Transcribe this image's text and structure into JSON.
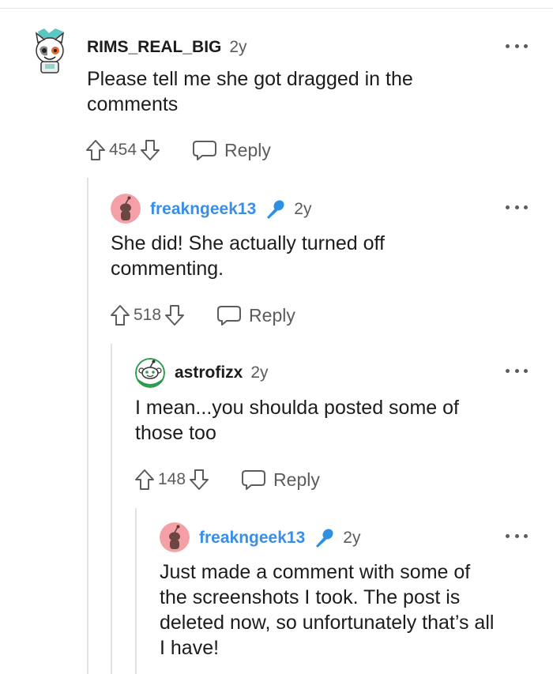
{
  "comments": [
    {
      "username": "RIMS_REAL_BIG",
      "age": "2y",
      "op": false,
      "avatar": "cat-avatar",
      "text": "Please tell me she got dragged in the\ncomments",
      "score": "454",
      "reply_label": "Reply"
    },
    {
      "username": "freakngeek13",
      "age": "2y",
      "op": true,
      "avatar": "snoo-pink-avatar",
      "text": "She did! She actually turned off\ncommenting.",
      "score": "518",
      "reply_label": "Reply"
    },
    {
      "username": "astrofizx",
      "age": "2y",
      "op": false,
      "avatar": "snoo-green-avatar",
      "text": "I mean...you shoulda posted some of\nthose too",
      "score": "148",
      "reply_label": "Reply"
    },
    {
      "username": "freakngeek13",
      "age": "2y",
      "op": true,
      "avatar": "snoo-pink-avatar",
      "text": "Just made a comment with some of\nthe screenshots I took. The post is\ndeleted now, so unfortunately that’s all\nI have!",
      "score": "",
      "reply_label": ""
    }
  ],
  "colors": {
    "op_username": "#3a8ee6",
    "text": "#1c1c1c",
    "meta": "#5c5c5c",
    "thread_line": "#e2e2e2"
  },
  "icons": [
    "upvote-icon",
    "downvote-icon",
    "reply-bubble-icon",
    "more-options-icon",
    "microphone-icon"
  ]
}
